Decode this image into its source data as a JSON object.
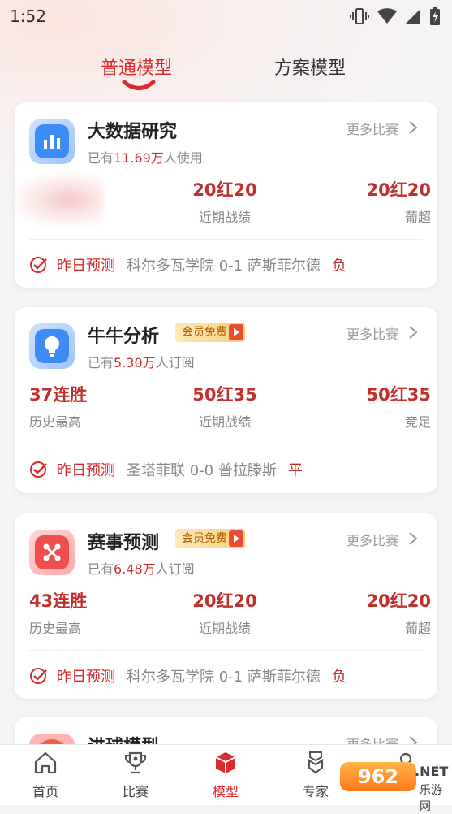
{
  "status_bar": {
    "time": "1:52"
  },
  "tabs": [
    {
      "label": "普通模型",
      "active": true
    },
    {
      "label": "方案模型",
      "active": false
    }
  ],
  "cards": [
    {
      "title": "大数据研究",
      "badge": "",
      "more": "更多比赛",
      "users_prefix": "已有",
      "users_count": "11.69万",
      "users_suffix": "人使用",
      "icon": "bar-chart-icon",
      "icon_color": "#3d8cf5",
      "stats": [
        {
          "value": "",
          "label": ""
        },
        {
          "value": "20红20",
          "label": "近期战绩"
        },
        {
          "value": "20红20",
          "label": "葡超"
        }
      ],
      "prediction": {
        "label": "昨日预测",
        "match": "科尔多瓦学院 0-1 萨斯菲尔德",
        "result": "负"
      }
    },
    {
      "title": "牛牛分析",
      "badge": "会员免费",
      "more": "更多比赛",
      "users_prefix": "已有",
      "users_count": "5.30万",
      "users_suffix": "人订阅",
      "icon": "lightbulb-icon",
      "icon_color": "#3d8cf5",
      "stats": [
        {
          "value": "37连胜",
          "label": "历史最高"
        },
        {
          "value": "50红35",
          "label": "近期战绩"
        },
        {
          "value": "50红35",
          "label": "竞足"
        }
      ],
      "prediction": {
        "label": "昨日预测",
        "match": "圣塔菲联 0-0 普拉滕斯",
        "result": "平"
      }
    },
    {
      "title": "赛事预测",
      "badge": "会员免费",
      "more": "更多比赛",
      "users_prefix": "已有",
      "users_count": "6.48万",
      "users_suffix": "人订阅",
      "icon": "scatter-icon",
      "icon_color": "#f04e4e",
      "stats": [
        {
          "value": "43连胜",
          "label": "历史最高"
        },
        {
          "value": "20红20",
          "label": "近期战绩"
        },
        {
          "value": "20红20",
          "label": "葡超"
        }
      ],
      "prediction": {
        "label": "昨日预测",
        "match": "科尔多瓦学院 0-1 萨斯菲尔德",
        "result": "负"
      }
    },
    {
      "title": "进球模型",
      "more": "更多比赛"
    }
  ],
  "bottom_nav": [
    {
      "label": "首页",
      "icon": "home-icon",
      "active": false
    },
    {
      "label": "比赛",
      "icon": "trophy-icon",
      "active": false
    },
    {
      "label": "模型",
      "icon": "cube-icon",
      "active": true
    },
    {
      "label": "专家",
      "icon": "badge-icon",
      "active": false
    },
    {
      "label": "",
      "icon": "user-icon",
      "active": false
    }
  ],
  "watermark": {
    "logo": "962",
    "net": ".NET",
    "sub": "乐游网"
  },
  "colors": {
    "accent": "#d92b2b",
    "stat_red": "#c0302f",
    "blue_icon": "#3d8cf5",
    "red_icon": "#f04e4e"
  }
}
